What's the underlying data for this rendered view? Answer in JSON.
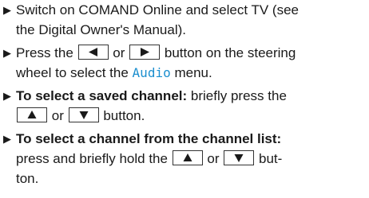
{
  "items": [
    {
      "line1": "Switch on COMAND Online and select TV (see",
      "line2": "the Digital Owner's Manual)."
    },
    {
      "l1_pre": "Press the",
      "l1_mid": "or",
      "l1_post": "button on the steering",
      "l2_pre": "wheel to select the",
      "l2_menu": "Audio",
      "l2_post": "menu.",
      "key_left_icon": "triangle-left-icon",
      "key_right_icon": "triangle-right-icon"
    },
    {
      "l1_bold": "To select a saved channel:",
      "l1_post": "briefly press the",
      "l2_mid": "or",
      "l2_post": "button.",
      "key_up_icon": "triangle-up-icon",
      "key_down_icon": "triangle-down-icon"
    },
    {
      "l1_bold": "To select a channel from the channel list:",
      "l2_pre": "press and briefly hold the",
      "l2_mid": "or",
      "l2_post": "but-",
      "l3": "ton.",
      "key_up_icon": "triangle-up-icon",
      "key_down_icon": "triangle-down-icon"
    }
  ],
  "colors": {
    "menu_word": "#1c8fcf",
    "text": "#1a1a1a"
  },
  "bullet_icon": "right-pointing-triangle-bullet-icon"
}
